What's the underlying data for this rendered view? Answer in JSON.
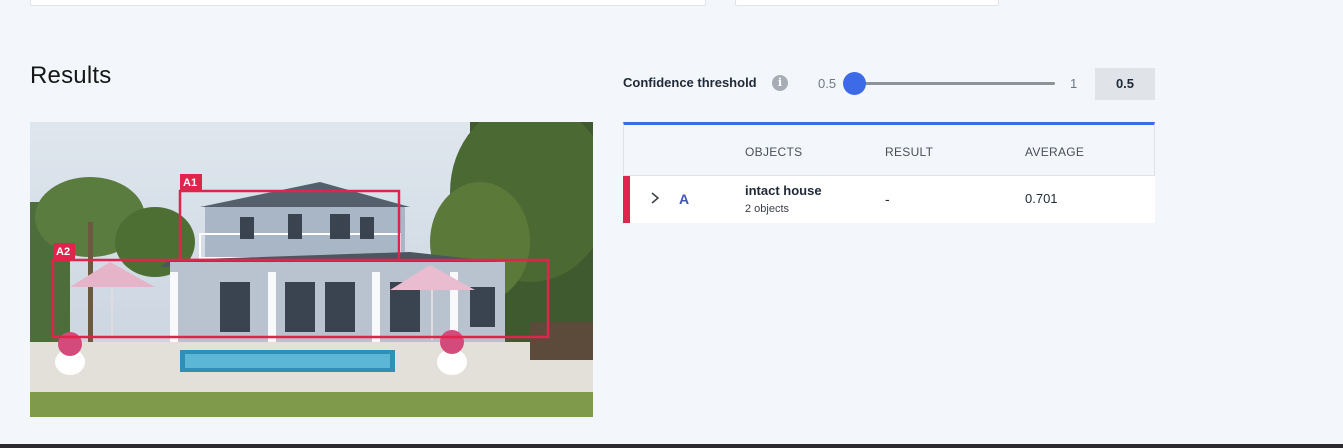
{
  "results": {
    "title": "Results"
  },
  "confidence": {
    "label": "Confidence threshold",
    "info_icon": "info-icon",
    "min_label": "0.5",
    "max_label": "1",
    "value_label": "0.5",
    "value": 0.5,
    "min": 0.5,
    "max": 1
  },
  "image": {
    "boxes": [
      {
        "label": "A1"
      },
      {
        "label": "A2"
      }
    ]
  },
  "table": {
    "headers": {
      "objects": "OBJECTS",
      "result": "RESULT",
      "average": "AVERAGE"
    },
    "rows": [
      {
        "letter": "A",
        "object": "intact house",
        "sub": "2 objects",
        "result": "-",
        "average": "0.701"
      }
    ]
  },
  "colors": {
    "accent": "#3d6be8",
    "box": "#e0254d"
  }
}
